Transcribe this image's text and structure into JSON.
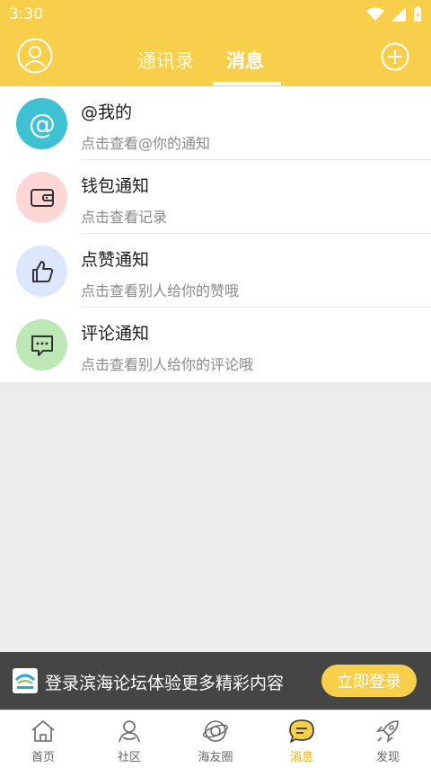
{
  "status_bar": {
    "time": "3:30"
  },
  "header": {
    "tabs": [
      {
        "label": "通讯录"
      },
      {
        "label": "消息"
      }
    ]
  },
  "notifications": [
    {
      "title": "@我的",
      "subtitle": "点击查看@你的通知",
      "icon": "at-icon",
      "color": "#3ec1d3"
    },
    {
      "title": "钱包通知",
      "subtitle": "点击查看记录",
      "icon": "wallet-icon",
      "color": "#ffd6d6"
    },
    {
      "title": "点赞通知",
      "subtitle": "点击查看别人给你的赞哦",
      "icon": "thumbs-up-icon",
      "color": "#dde6ff"
    },
    {
      "title": "评论通知",
      "subtitle": "点击查看别人给你的评论哦",
      "icon": "comment-icon",
      "color": "#bde8b6"
    }
  ],
  "login_banner": {
    "text": "登录滨海论坛体验更多精彩内容",
    "button": "立即登录"
  },
  "bottom_nav": [
    {
      "label": "首页",
      "icon": "home-icon"
    },
    {
      "label": "社区",
      "icon": "community-icon"
    },
    {
      "label": "海友圈",
      "icon": "planet-icon"
    },
    {
      "label": "消息",
      "icon": "message-icon",
      "active": true
    },
    {
      "label": "发现",
      "icon": "rocket-icon"
    }
  ],
  "colors": {
    "accent": "#f7cf4a",
    "active": "#e8b300"
  }
}
